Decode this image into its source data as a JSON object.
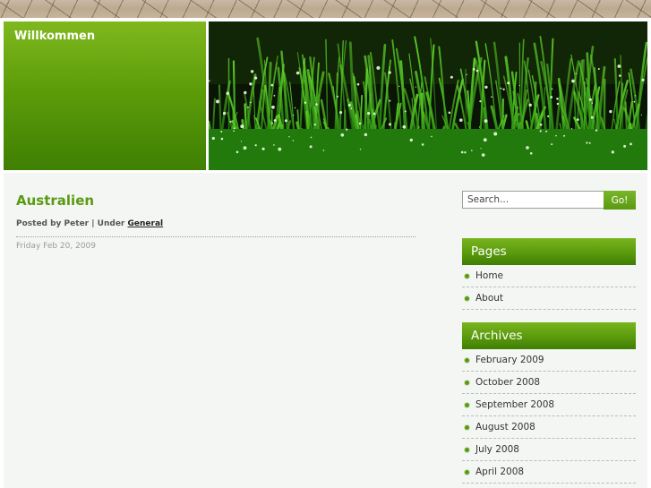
{
  "header": {
    "site_title": "Willkommen"
  },
  "post": {
    "title": "Australien",
    "meta_prefix": "Posted by Peter | Under ",
    "category_link": "General",
    "date": "Friday Feb 20, 2009"
  },
  "search": {
    "placeholder": "Search...",
    "button_label": "Go!"
  },
  "sidebar": {
    "pages": {
      "heading": "Pages",
      "items": [
        {
          "label": "Home"
        },
        {
          "label": "About"
        }
      ]
    },
    "archives": {
      "heading": "Archives",
      "items": [
        {
          "label": "February 2009"
        },
        {
          "label": "October 2008"
        },
        {
          "label": "September 2008"
        },
        {
          "label": "August 2008"
        },
        {
          "label": "July 2008"
        },
        {
          "label": "April 2008"
        }
      ]
    }
  },
  "colors": {
    "accent_green": "#5a9a12",
    "header_green": "#6aa814",
    "content_bg": "#f4f6f4"
  }
}
